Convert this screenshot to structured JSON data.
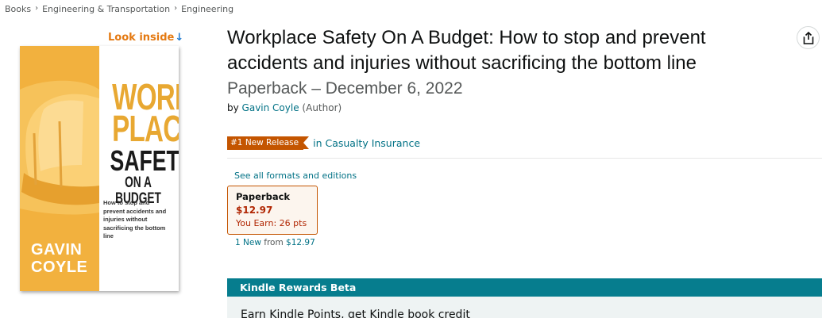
{
  "breadcrumb": {
    "items": [
      "Books",
      "Engineering & Transportation",
      "Engineering"
    ],
    "separator": "›"
  },
  "look_inside": {
    "label": "Look inside",
    "arrow": "↓"
  },
  "cover": {
    "title_lines": [
      "WORK",
      "PLACE"
    ],
    "title_safety": "SAFETY",
    "title_budget": "ON A BUDGET",
    "subtitle": "How to stop and prevent accidents and injuries without sacrificing the bottom line",
    "author_lines": [
      "GAVIN",
      "COYLE"
    ],
    "colors": {
      "background": "#f2b13e",
      "accent_text": "#e8a832"
    }
  },
  "product": {
    "title": "Workplace Safety On A Budget: How to stop and prevent accidents and injuries without sacrificing the bottom line",
    "edition": "Paperback – December 6, 2022",
    "by_label": "by",
    "author": "Gavin Coyle",
    "author_role": "(Author)"
  },
  "share": {
    "icon": "share-icon"
  },
  "badge": {
    "label": "#1 New Release",
    "category": "in Casualty Insurance",
    "color": "#c45500"
  },
  "formats": {
    "see_all_label": "See all formats and editions",
    "selected": {
      "name": "Paperback",
      "price": "$12.97",
      "earn": "You Earn: 26 pts"
    },
    "offers": {
      "count_label": "1 New",
      "from_label": "from",
      "price": "$12.97"
    }
  },
  "kindle_rewards": {
    "header": "Kindle Rewards Beta",
    "body": "Earn Kindle Points, get Kindle book credit",
    "color": "#067d8e"
  }
}
